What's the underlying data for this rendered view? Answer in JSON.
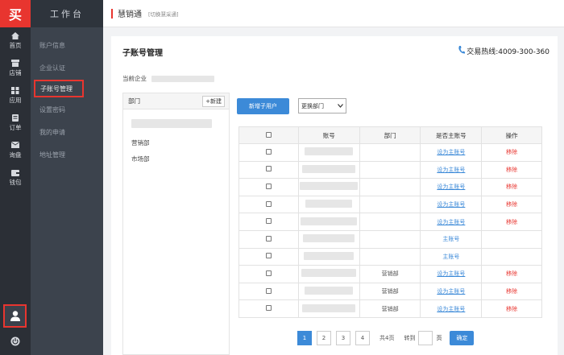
{
  "rail": {
    "logo": "买",
    "items": [
      {
        "label": "首页",
        "icon": "home-icon"
      },
      {
        "label": "店铺",
        "icon": "shop-icon"
      },
      {
        "label": "应用",
        "icon": "apps-icon"
      },
      {
        "label": "订单",
        "icon": "order-icon"
      },
      {
        "label": "询盘",
        "icon": "inquiry-icon"
      },
      {
        "label": "钱包",
        "icon": "wallet-icon"
      }
    ],
    "user_icon": "user-icon",
    "power_icon": "power-icon"
  },
  "menu": {
    "title": "工作台",
    "items": [
      {
        "label": "账户信息"
      },
      {
        "label": "企业认证"
      },
      {
        "label": "子账号管理",
        "active": true
      },
      {
        "label": "设置密码"
      },
      {
        "label": "我的申请"
      },
      {
        "label": "地址管理"
      }
    ]
  },
  "topbar": {
    "title": "慧销通",
    "switch_label": "[切换慧采通]"
  },
  "page": {
    "title": "子账号管理",
    "hotline": "交易热线:4009-300-360",
    "company_label": "当前企业"
  },
  "dept_panel": {
    "header": "部门",
    "new_button": "+新建",
    "departments": [
      "营销部",
      "市场部"
    ]
  },
  "toolbar": {
    "add_button": "新增子用户",
    "change_dept_select": "更换部门"
  },
  "table": {
    "headers": [
      "",
      "账号",
      "部门",
      "是否主账号",
      "操作"
    ],
    "rows": [
      {
        "dept": "",
        "master": "设为主账号",
        "is_master": false,
        "action": "移除"
      },
      {
        "dept": "",
        "master": "设为主账号",
        "is_master": false,
        "action": "移除"
      },
      {
        "dept": "",
        "master": "设为主账号",
        "is_master": false,
        "action": "移除"
      },
      {
        "dept": "",
        "master": "设为主账号",
        "is_master": false,
        "action": "移除"
      },
      {
        "dept": "",
        "master": "设为主账号",
        "is_master": false,
        "action": "移除"
      },
      {
        "dept": "",
        "master": "主账号",
        "is_master": true,
        "action": ""
      },
      {
        "dept": "",
        "master": "主账号",
        "is_master": true,
        "action": ""
      },
      {
        "dept": "营销部",
        "master": "设为主账号",
        "is_master": false,
        "action": "移除"
      },
      {
        "dept": "营销部",
        "master": "设为主账号",
        "is_master": false,
        "action": "移除"
      },
      {
        "dept": "营销部",
        "master": "设为主账号",
        "is_master": false,
        "action": "移除"
      }
    ]
  },
  "pager": {
    "pages": [
      "1",
      "2",
      "3",
      "4"
    ],
    "current": "1",
    "total_text": "共4页",
    "goto_label": "转到",
    "page_suffix": "页",
    "confirm": "确定"
  },
  "colors": {
    "accent": "#e8352f",
    "primary": "#3c8ad8",
    "rail_bg": "#2b2f36",
    "menu_bg": "#3c434d"
  }
}
